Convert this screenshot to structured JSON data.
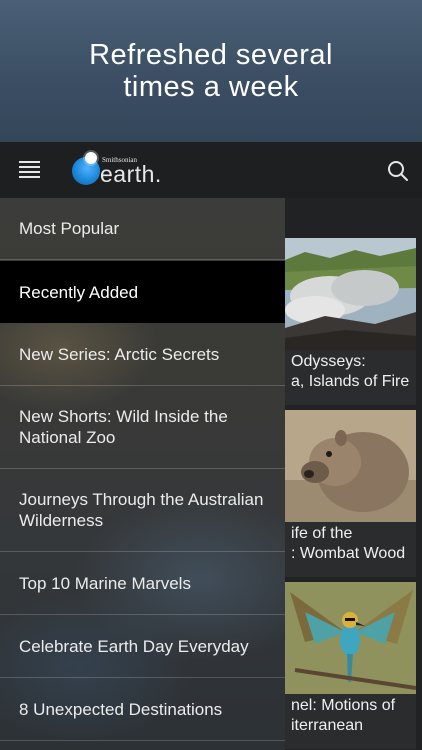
{
  "promo": {
    "headline": "Refreshed several times a week"
  },
  "appbar": {
    "logo_small": "Smithsonian",
    "logo_word": "earth."
  },
  "drawer": {
    "items": [
      {
        "label": "Most Popular"
      },
      {
        "label": "Recently Added",
        "selected": true
      },
      {
        "label": "New Series: Arctic Secrets"
      },
      {
        "label": "New Shorts: Wild Inside the National Zoo"
      },
      {
        "label": "Journeys Through the Australian Wilderness"
      },
      {
        "label": "Top 10 Marine Marvels"
      },
      {
        "label": "Celebrate Earth Day Everyday"
      },
      {
        "label": "8 Unexpected Destinations"
      }
    ]
  },
  "content": {
    "cards": [
      {
        "line1": "Odysseys:",
        "line2": "a, Islands of Fire"
      },
      {
        "line1": "ife of the",
        "line2": ": Wombat Wood"
      },
      {
        "line1": "nel: Motions of",
        "line2": "iterranean"
      }
    ]
  },
  "colors": {
    "active_bg": "#000000",
    "accent": "#1b86d8"
  }
}
